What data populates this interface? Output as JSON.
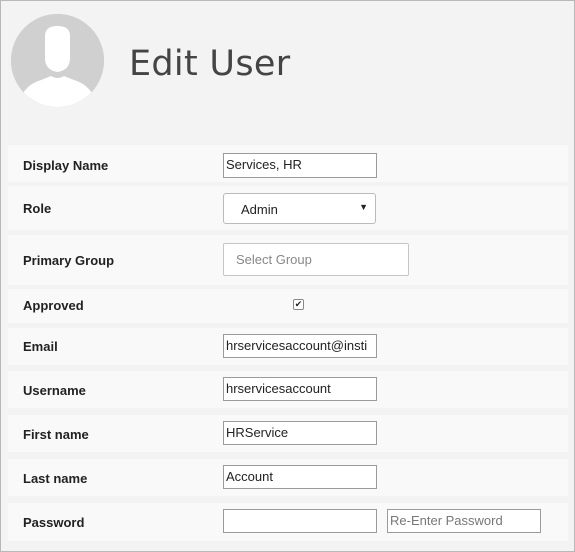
{
  "header": {
    "title": "Edit User"
  },
  "fields": {
    "display_name": {
      "label": "Display Name",
      "value": "Services, HR"
    },
    "role": {
      "label": "Role",
      "value": "Admin"
    },
    "primary_group": {
      "label": "Primary Group",
      "placeholder": "Select Group"
    },
    "approved": {
      "label": "Approved",
      "checked": true,
      "check_glyph": "✔"
    },
    "email": {
      "label": "Email",
      "value": "hrservicesaccount@insti"
    },
    "username": {
      "label": "Username",
      "value": "hrservicesaccount"
    },
    "first_name": {
      "label": "First name",
      "value": "HRService"
    },
    "last_name": {
      "label": "Last name",
      "value": "Account"
    },
    "password": {
      "label": "Password",
      "value": "",
      "reenter_placeholder": "Re-Enter Password"
    }
  },
  "icons": {
    "avatar": "user-silhouette-icon",
    "role_caret": "chevron-down-icon",
    "approved": "checkmark-icon"
  }
}
